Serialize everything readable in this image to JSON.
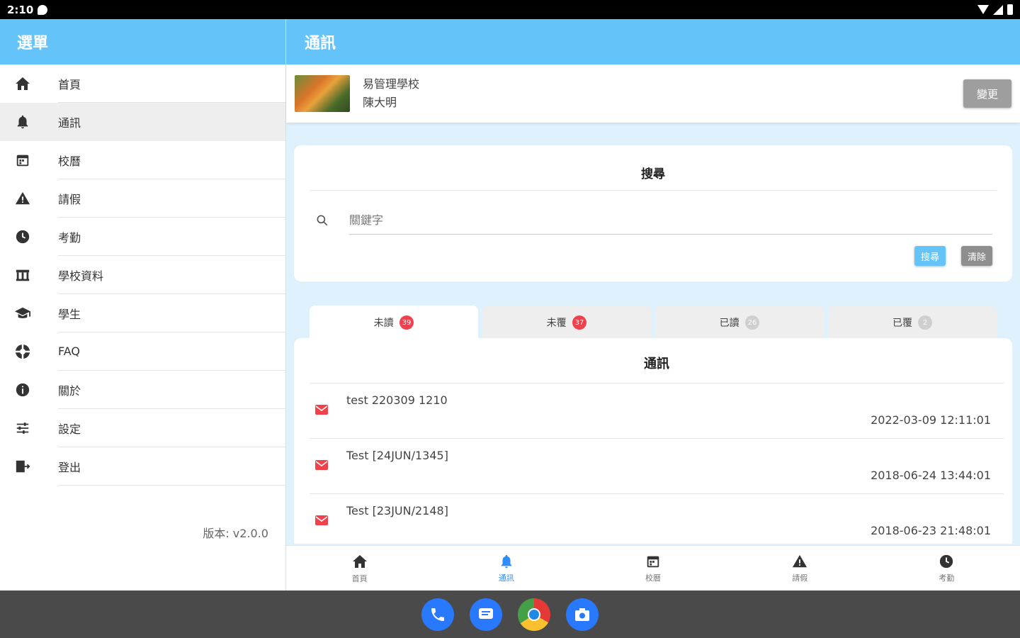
{
  "status_bar": {
    "time": "2:10"
  },
  "drawer": {
    "title": "選單",
    "items": [
      {
        "label": "首頁",
        "icon": "home-icon"
      },
      {
        "label": "通訊",
        "icon": "bell-icon"
      },
      {
        "label": "校曆",
        "icon": "calendar-icon"
      },
      {
        "label": "請假",
        "icon": "warning-icon"
      },
      {
        "label": "考勤",
        "icon": "clock-icon"
      },
      {
        "label": "學校資料",
        "icon": "school-icon"
      },
      {
        "label": "學生",
        "icon": "graduation-cap-icon"
      },
      {
        "label": "FAQ",
        "icon": "lifebuoy-icon"
      },
      {
        "label": "關於",
        "icon": "info-icon"
      },
      {
        "label": "設定",
        "icon": "sliders-icon"
      },
      {
        "label": "登出",
        "icon": "logout-icon"
      }
    ],
    "active_index": 1,
    "version": "版本: v2.0.0"
  },
  "header": {
    "title": "通訊"
  },
  "user": {
    "school": "易管理學校",
    "name": "陳大明",
    "change_label": "變更"
  },
  "search": {
    "title": "搜尋",
    "placeholder": "關鍵字",
    "search_label": "搜尋",
    "clear_label": "清除"
  },
  "tabs": [
    {
      "label": "未讀",
      "count": "39"
    },
    {
      "label": "未覆",
      "count": "37"
    },
    {
      "label": "已讀",
      "count": "26"
    },
    {
      "label": "已覆",
      "count": "2"
    }
  ],
  "list": {
    "title": "通訊",
    "items": [
      {
        "title": "test 220309 1210",
        "date": "2022-03-09 12:11:01"
      },
      {
        "title": "Test [24JUN/1345]",
        "date": "2018-06-24 13:44:01"
      },
      {
        "title": "Test [23JUN/2148]",
        "date": "2018-06-23 21:48:01"
      }
    ]
  },
  "bottom_nav": [
    {
      "label": "首頁",
      "icon": "home-icon"
    },
    {
      "label": "通訊",
      "icon": "bell-icon"
    },
    {
      "label": "校曆",
      "icon": "calendar-icon"
    },
    {
      "label": "請假",
      "icon": "warning-icon"
    },
    {
      "label": "考勤",
      "icon": "clock-icon"
    }
  ],
  "colors": {
    "header": "#64c4fa",
    "accent": "#2f8cff",
    "badge_red": "#f0424c",
    "content_bg": "#dff1fd"
  }
}
